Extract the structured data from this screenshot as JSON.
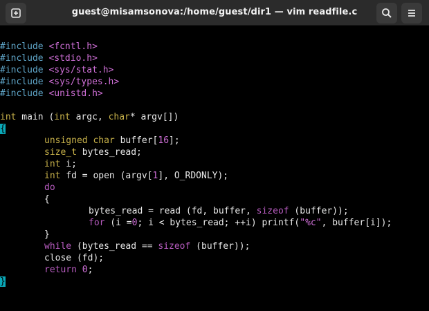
{
  "window": {
    "title": "guest@misamsonova:/home/guest/dir1 — vim readfile.c",
    "new_tab_icon": "new-tab-icon",
    "search_icon": "search-icon",
    "menu_icon": "hamburger-menu-icon"
  },
  "code": {
    "l1": {
      "a": "#include",
      "b": "<fcntl.h>"
    },
    "l2": {
      "a": "#include",
      "b": "<stdio.h>"
    },
    "l3": {
      "a": "#include",
      "b": "<sys/stat.h>"
    },
    "l4": {
      "a": "#include",
      "b": "<sys/types.h>"
    },
    "l5": {
      "a": "#include",
      "b": "<unistd.h>"
    },
    "l7": {
      "a": "int",
      "b": " main (",
      "c": "int",
      "d": " argc, ",
      "e": "char",
      "f": "* argv[])"
    },
    "l8": {
      "a": "{"
    },
    "l9": {
      "a": "unsigned",
      "b": " ",
      "c": "char",
      "d": " buffer[",
      "e": "16",
      "f": "];"
    },
    "l10": {
      "a": "size_t",
      "b": " bytes_read;"
    },
    "l11": {
      "a": "int",
      "b": " i;"
    },
    "l12": {
      "a": "int",
      "b": " fd = open (argv[",
      "c": "1",
      "d": "], O_RDONLY);"
    },
    "l13": {
      "a": "do"
    },
    "l14": {
      "a": "{"
    },
    "l15": {
      "a": "bytes_read = read (fd, buffer, ",
      "b": "sizeof",
      "c": " (buffer));"
    },
    "l16": {
      "a": "for",
      "b": " (i =",
      "c": "0",
      "d": "; i < bytes_read; ++i) printf(",
      "e": "\"%c\"",
      "f": ", buffer[i]);"
    },
    "l17": {
      "a": "}"
    },
    "l18": {
      "a": "while",
      "b": " (bytes_read == ",
      "c": "sizeof",
      "d": " (buffer));"
    },
    "l19": {
      "a": "close (fd);"
    },
    "l20": {
      "a": "return",
      "b": " ",
      "c": "0",
      "d": ";"
    },
    "l21": {
      "a": "}"
    }
  },
  "colors": {
    "preprocessor": "#5fa5c8",
    "string": "#d070d8",
    "type": "#c8b24a",
    "keyword": "#b85cc0",
    "cursor": "#0aa8b8"
  }
}
